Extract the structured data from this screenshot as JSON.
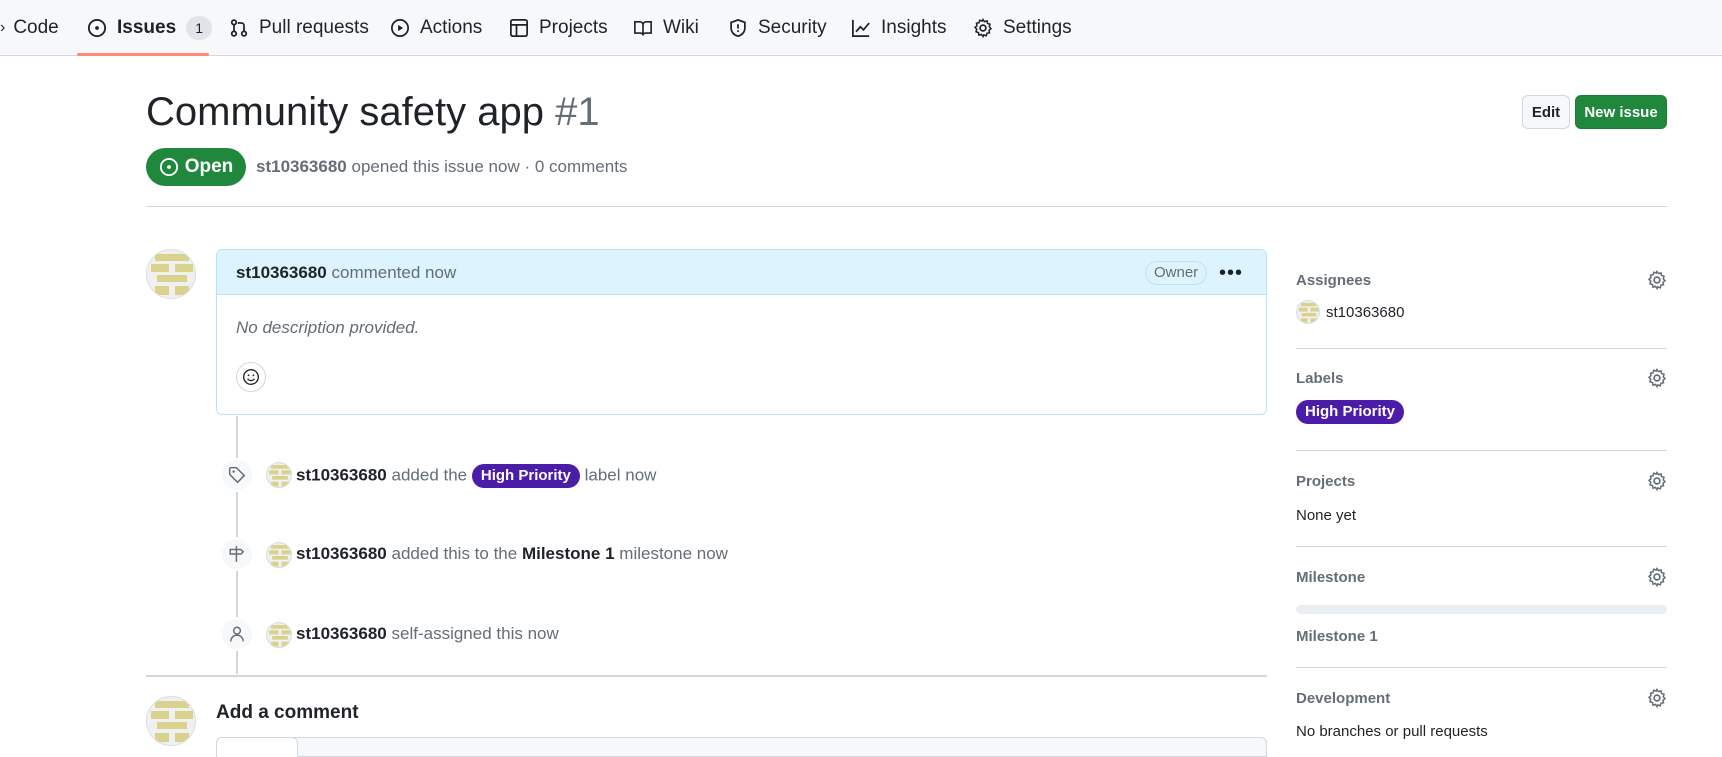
{
  "tabs": [
    {
      "label": "Code"
    },
    {
      "label": "Issues",
      "count": "1"
    },
    {
      "label": "Pull requests"
    },
    {
      "label": "Actions"
    },
    {
      "label": "Projects"
    },
    {
      "label": "Wiki"
    },
    {
      "label": "Security"
    },
    {
      "label": "Insights"
    },
    {
      "label": "Settings"
    }
  ],
  "issue": {
    "title": "Community safety app",
    "number": "#1",
    "state": "Open",
    "author": "st10363680",
    "meta_text": "opened this issue now · 0 comments"
  },
  "actions": {
    "edit": "Edit",
    "new_issue": "New issue"
  },
  "comment": {
    "author": "st10363680",
    "action": "commented now",
    "badge": "Owner",
    "body": "No description provided."
  },
  "events": [
    {
      "actor": "st10363680",
      "pre": "added the",
      "label": "High Priority",
      "post": "label now",
      "icon": "tag-icon"
    },
    {
      "actor": "st10363680",
      "pre": "added this to the",
      "milestone": "Milestone 1",
      "post": "milestone now",
      "icon": "milestone-icon"
    },
    {
      "actor": "st10363680",
      "pre": "self-assigned this now",
      "icon": "person-icon"
    }
  ],
  "add_comment": "Add a comment",
  "sidebar": {
    "assignees": {
      "title": "Assignees",
      "value": "st10363680"
    },
    "labels": {
      "title": "Labels",
      "value": "High Priority",
      "color": "#4a1ca8"
    },
    "projects": {
      "title": "Projects",
      "value": "None yet"
    },
    "milestone": {
      "title": "Milestone",
      "value": "Milestone 1",
      "progress": 0
    },
    "development": {
      "title": "Development",
      "value": "No branches or pull requests"
    }
  },
  "colors": {
    "accent": "#1f883d",
    "tab_underline": "#fd8c73",
    "label": "#4a1ca8"
  }
}
